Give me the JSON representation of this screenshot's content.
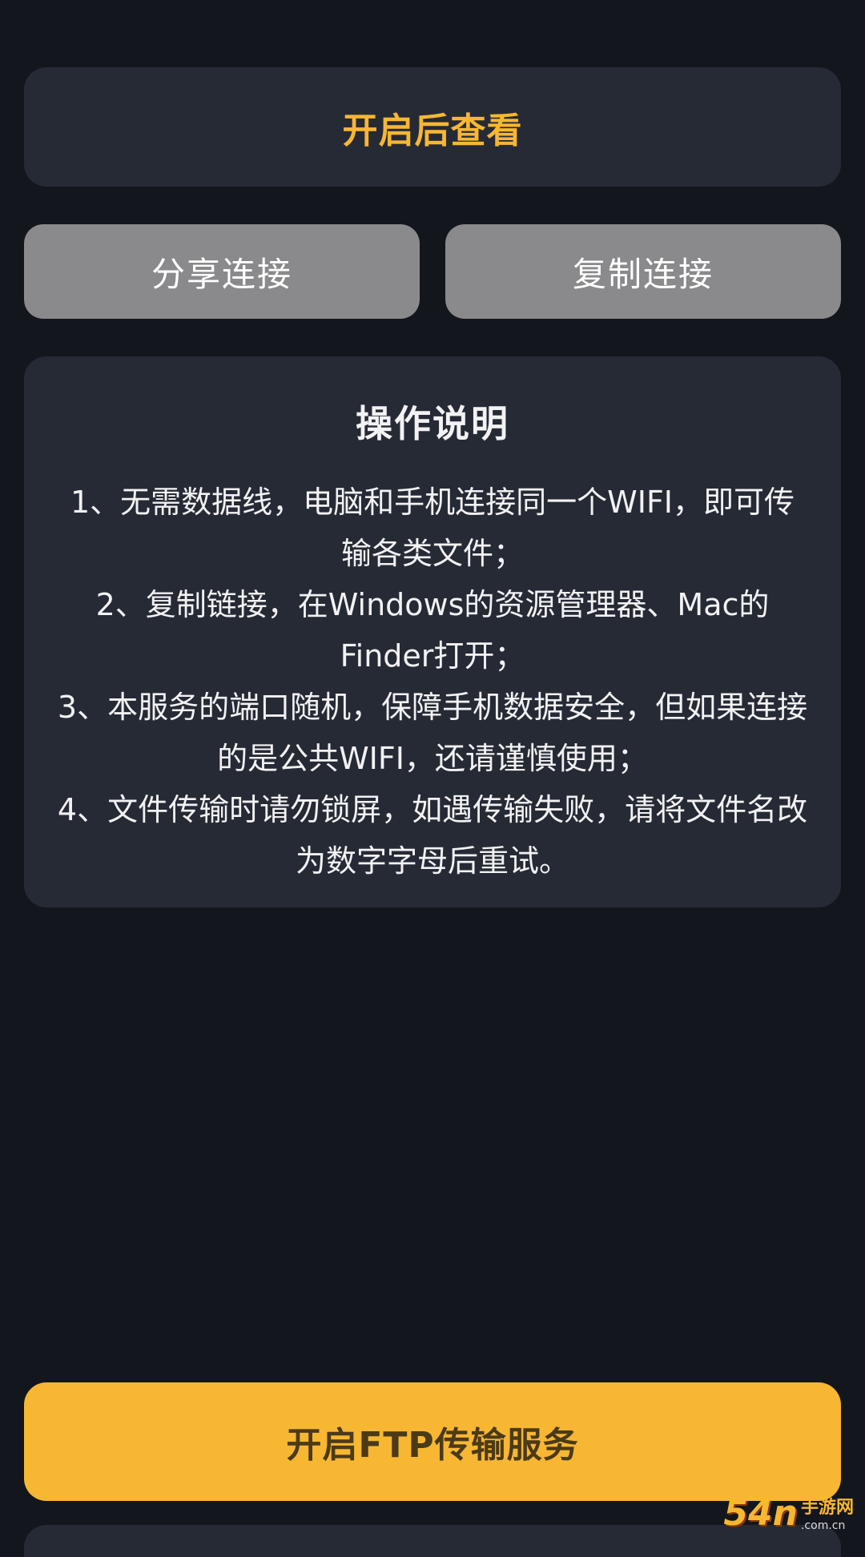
{
  "view_card": {
    "label": "开启后查看"
  },
  "actions": {
    "share_label": "分享连接",
    "copy_label": "复制连接"
  },
  "instructions": {
    "title": "操作说明",
    "steps": [
      "1、无需数据线，电脑和手机连接同一个WIFI，即可传输各类文件；",
      "2、复制链接，在Windows的资源管理器、Mac的Finder打开；",
      "3、本服务的端口随机，保障手机数据安全，但如果连接的是公共WIFI，还请谨慎使用；",
      "4、文件传输时请勿锁屏，如遇传输失败，请将文件名改为数字字母后重试。"
    ]
  },
  "start_button": {
    "label": "开启FTP传输服务"
  },
  "watermark": {
    "logo": "54n",
    "text_top": "手游网",
    "text_bottom": ".com.cn"
  },
  "colors": {
    "background": "#14161d",
    "card": "#262a35",
    "accent": "#f7b733",
    "gray_button": "#8a8a8c"
  }
}
